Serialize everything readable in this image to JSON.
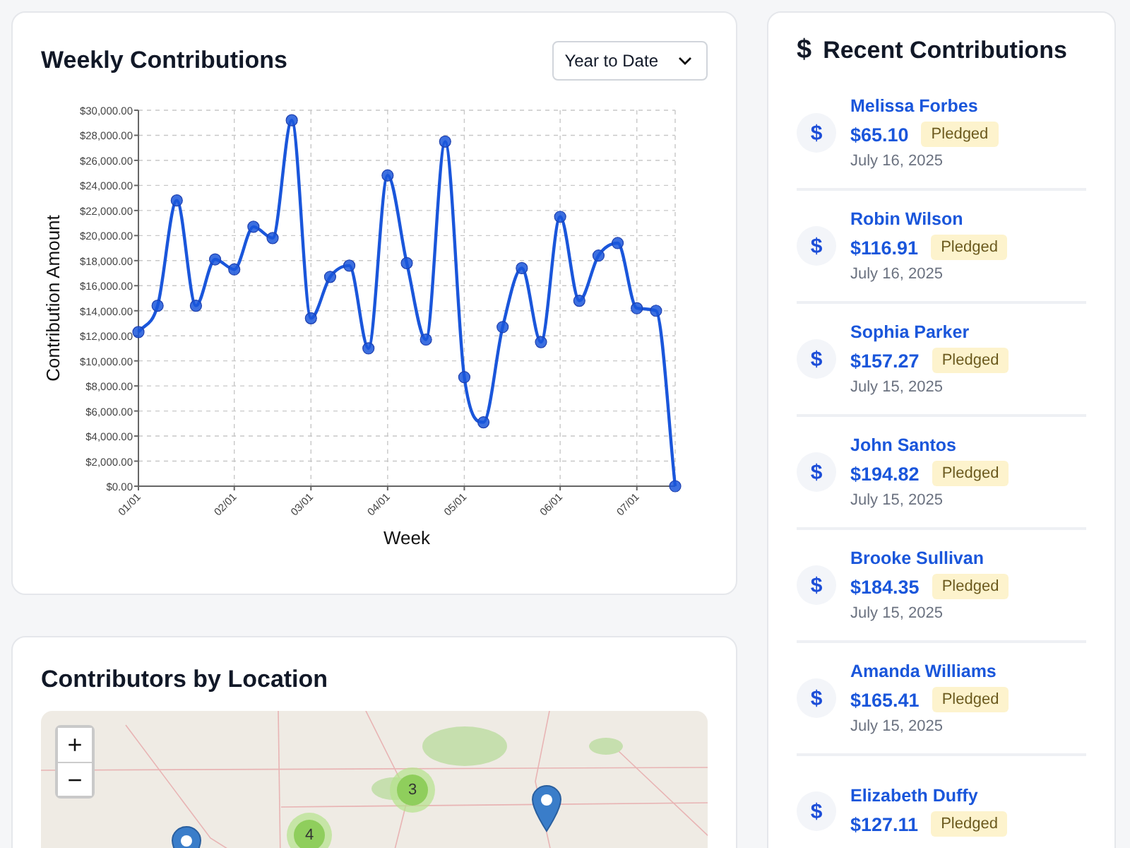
{
  "weekly_contributions": {
    "title": "Weekly Contributions",
    "range_dropdown": {
      "value": "Year to Date"
    },
    "chart_data": {
      "type": "line",
      "xlabel": "Week",
      "ylabel": "Contribution Amount",
      "categories": [
        "01/01",
        null,
        null,
        null,
        null,
        "02/01",
        null,
        null,
        null,
        "03/01",
        null,
        null,
        null,
        "04/01",
        null,
        null,
        null,
        "05/01",
        null,
        null,
        null,
        null,
        "06/01",
        null,
        null,
        null,
        "07/01",
        null,
        null
      ],
      "grid": true,
      "series": [
        {
          "color": "#1a56db",
          "marker": true,
          "values": [
            12300,
            14400,
            22800,
            14400,
            18100,
            17300,
            20700,
            19800,
            29200,
            13400,
            16700,
            17600,
            11000,
            24800,
            17800,
            11700,
            27500,
            8700,
            5100,
            12700,
            17400,
            11500,
            21500,
            14800,
            18400,
            19400,
            14200,
            14000,
            0
          ]
        }
      ],
      "ylim": [
        0,
        30000
      ],
      "yticks": [
        {
          "value": 0,
          "label": "$0.00"
        },
        {
          "value": 2000,
          "label": "$2,000.00"
        },
        {
          "value": 4000,
          "label": "$4,000.00"
        },
        {
          "value": 6000,
          "label": "$6,000.00"
        },
        {
          "value": 8000,
          "label": "$8,000.00"
        },
        {
          "value": 10000,
          "label": "$10,000.00"
        },
        {
          "value": 12000,
          "label": "$12,000.00"
        },
        {
          "value": 14000,
          "label": "$14,000.00"
        },
        {
          "value": 16000,
          "label": "$16,000.00"
        },
        {
          "value": 18000,
          "label": "$18,000.00"
        },
        {
          "value": 20000,
          "label": "$20,000.00"
        },
        {
          "value": 22000,
          "label": "$22,000.00"
        },
        {
          "value": 24000,
          "label": "$24,000.00"
        },
        {
          "value": 26000,
          "label": "$26,000.00"
        },
        {
          "value": 28000,
          "label": "$28,000.00"
        },
        {
          "value": 30000,
          "label": "$30,000.00"
        }
      ]
    }
  },
  "contributors_by_location": {
    "title": "Contributors by Location",
    "zoom_in": "+",
    "zoom_out": "−",
    "clusters": [
      {
        "count": "3"
      },
      {
        "count": "4"
      }
    ]
  },
  "recent_contributions": {
    "icon": "$",
    "title": "Recent Contributions",
    "items": [
      {
        "icon": "$",
        "name": "Melissa Forbes",
        "amount": "$65.10",
        "status": "Pledged",
        "date": "July 16, 2025"
      },
      {
        "icon": "$",
        "name": "Robin Wilson",
        "amount": "$116.91",
        "status": "Pledged",
        "date": "July 16, 2025"
      },
      {
        "icon": "$",
        "name": "Sophia Parker",
        "amount": "$157.27",
        "status": "Pledged",
        "date": "July 15, 2025"
      },
      {
        "icon": "$",
        "name": "John Santos",
        "amount": "$194.82",
        "status": "Pledged",
        "date": "July 15, 2025"
      },
      {
        "icon": "$",
        "name": "Brooke Sullivan",
        "amount": "$184.35",
        "status": "Pledged",
        "date": "July 15, 2025"
      },
      {
        "icon": "$",
        "name": "Amanda Williams",
        "amount": "$165.41",
        "status": "Pledged",
        "date": "July 15, 2025"
      },
      {
        "icon": "$",
        "name": "Elizabeth Duffy",
        "amount": "$127.11",
        "status": "Pledged"
      }
    ]
  }
}
